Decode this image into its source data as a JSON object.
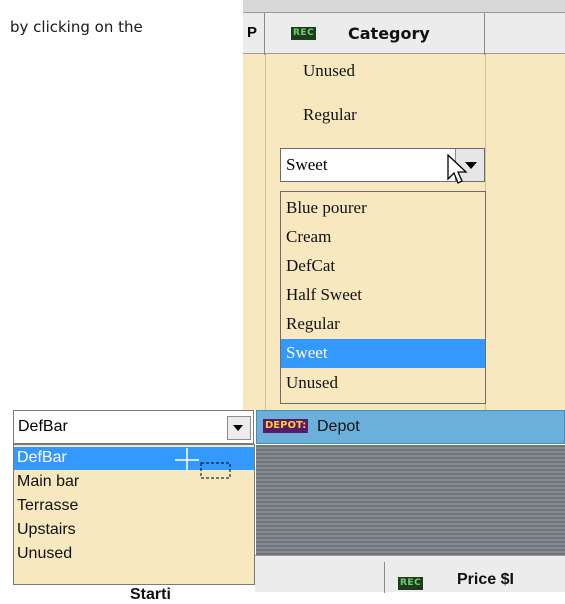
{
  "doc": {
    "text": "by clicking on the"
  },
  "top_grid": {
    "col_p": "P",
    "col_category": {
      "badge": "REC",
      "label": "Category"
    },
    "rows": [
      "Unused",
      "Regular"
    ],
    "combo": {
      "value": "Sweet"
    },
    "options": [
      "Blue pourer",
      "Cream",
      "DefCat",
      "Half Sweet",
      "Regular",
      "Sweet",
      "Unused"
    ],
    "selected": "Sweet"
  },
  "bottom": {
    "combo": {
      "value": "DefBar"
    },
    "depot": {
      "badge": "DEPOT:",
      "label": "Depot"
    },
    "options": [
      "DefBar",
      "Main bar",
      "Terrasse",
      "Upstairs",
      "Unused"
    ],
    "selected": "DefBar",
    "header": {
      "partial_label": "Starti",
      "price_badge": "REC",
      "price_label": "Price $I"
    }
  },
  "colors": {
    "cell_bg": "#f7e8bf",
    "selection": "#3399ff",
    "depot_bar": "#6ab0da"
  }
}
